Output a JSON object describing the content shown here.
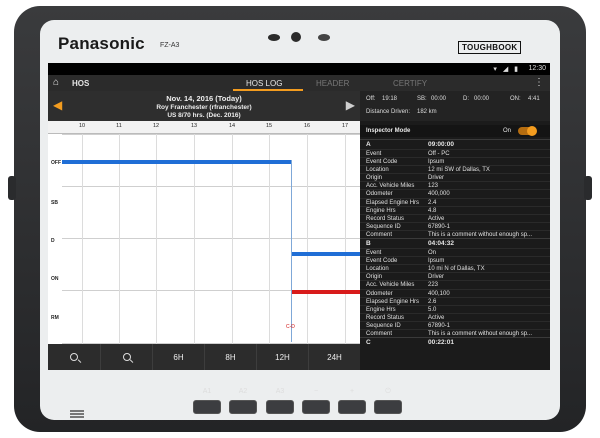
{
  "device": {
    "brand": "Panasonic",
    "model": "FZ-A3",
    "badge": "TOUGHBOOK"
  },
  "statusbar": {
    "time": "12:30",
    "icons": "▾ ◢ ▮"
  },
  "appbar": {
    "home_icon": "home-icon",
    "title": "HOS",
    "tabs": [
      "HOS LOG",
      "HEADER",
      "CERTIFY"
    ],
    "active_tab": "HOS LOG",
    "menu_icon": "more-vert-icon"
  },
  "log": {
    "date": "Nov. 14, 2016 (Today)",
    "driver": "Roy Franchester (rfranchester)",
    "rule": "US 8/70 hrs. (Dec. 2016)",
    "hours": [
      "10",
      "11",
      "12",
      "13",
      "14",
      "15",
      "16",
      "17"
    ],
    "rows": [
      "OFF",
      "SB",
      "D",
      "ON",
      "RM"
    ],
    "marker": "C-D"
  },
  "toolbar": {
    "zoom_out_icon": "zoom-out-icon",
    "zoom_in_icon": "zoom-in-icon",
    "b6": "6H",
    "b8": "8H",
    "b12": "12H",
    "b24": "24H"
  },
  "summary": {
    "off": "Off:",
    "off_v": "19:18",
    "sb": "SB:",
    "sb_v": "00:00",
    "d": "D:",
    "d_v": "00:00",
    "on": "ON:",
    "on_v": "4:41",
    "dist": "Distance Driven:",
    "dist_v": "182 km"
  },
  "inspector": {
    "label": "Inspector Mode",
    "state": "On"
  },
  "events": [
    {
      "id": "A",
      "time": "09:00:00",
      "rows": [
        [
          "Event",
          "Off - PC"
        ],
        [
          "Event Code",
          "Ipsum"
        ],
        [
          "Location",
          "12 mi SW of Dallas, TX"
        ],
        [
          "Origin",
          "Driver"
        ],
        [
          "Acc. Vehicle Miles",
          "123"
        ],
        [
          "Odometer",
          "400,000"
        ],
        [
          "Elapsed Engine Hrs",
          "2.4"
        ],
        [
          "Engine Hrs",
          "4.8"
        ],
        [
          "Record Status",
          "Active"
        ],
        [
          "Sequence ID",
          "67890-1"
        ],
        [
          "Comment",
          "This is a comment without enough sp..."
        ]
      ]
    },
    {
      "id": "B",
      "time": "04:04:32",
      "rows": [
        [
          "Event",
          "On"
        ],
        [
          "Event Code",
          "Ipsum"
        ],
        [
          "Location",
          "10 mi N of Dallas, TX"
        ],
        [
          "Origin",
          "Driver"
        ],
        [
          "Acc. Vehicle Miles",
          "223"
        ],
        [
          "Odometer",
          "400,100"
        ],
        [
          "Elapsed Engine Hrs",
          "2.6"
        ],
        [
          "Engine Hrs",
          "5.0"
        ],
        [
          "Record Status",
          "Active"
        ],
        [
          "Sequence ID",
          "67890-1"
        ],
        [
          "Comment",
          "This is a comment without enough sp..."
        ]
      ]
    },
    {
      "id": "C",
      "time": "00:22:01",
      "rows": []
    }
  ],
  "nav": {
    "a1": "A1",
    "a2": "A2",
    "a3": "A3",
    "minus": "−",
    "plus": "+",
    "power_icon": "power-icon",
    "power": "⏻"
  },
  "colors": {
    "accent": "#f39c1f",
    "off_line": "#1f6ed6",
    "on_line": "#d81b1b"
  }
}
